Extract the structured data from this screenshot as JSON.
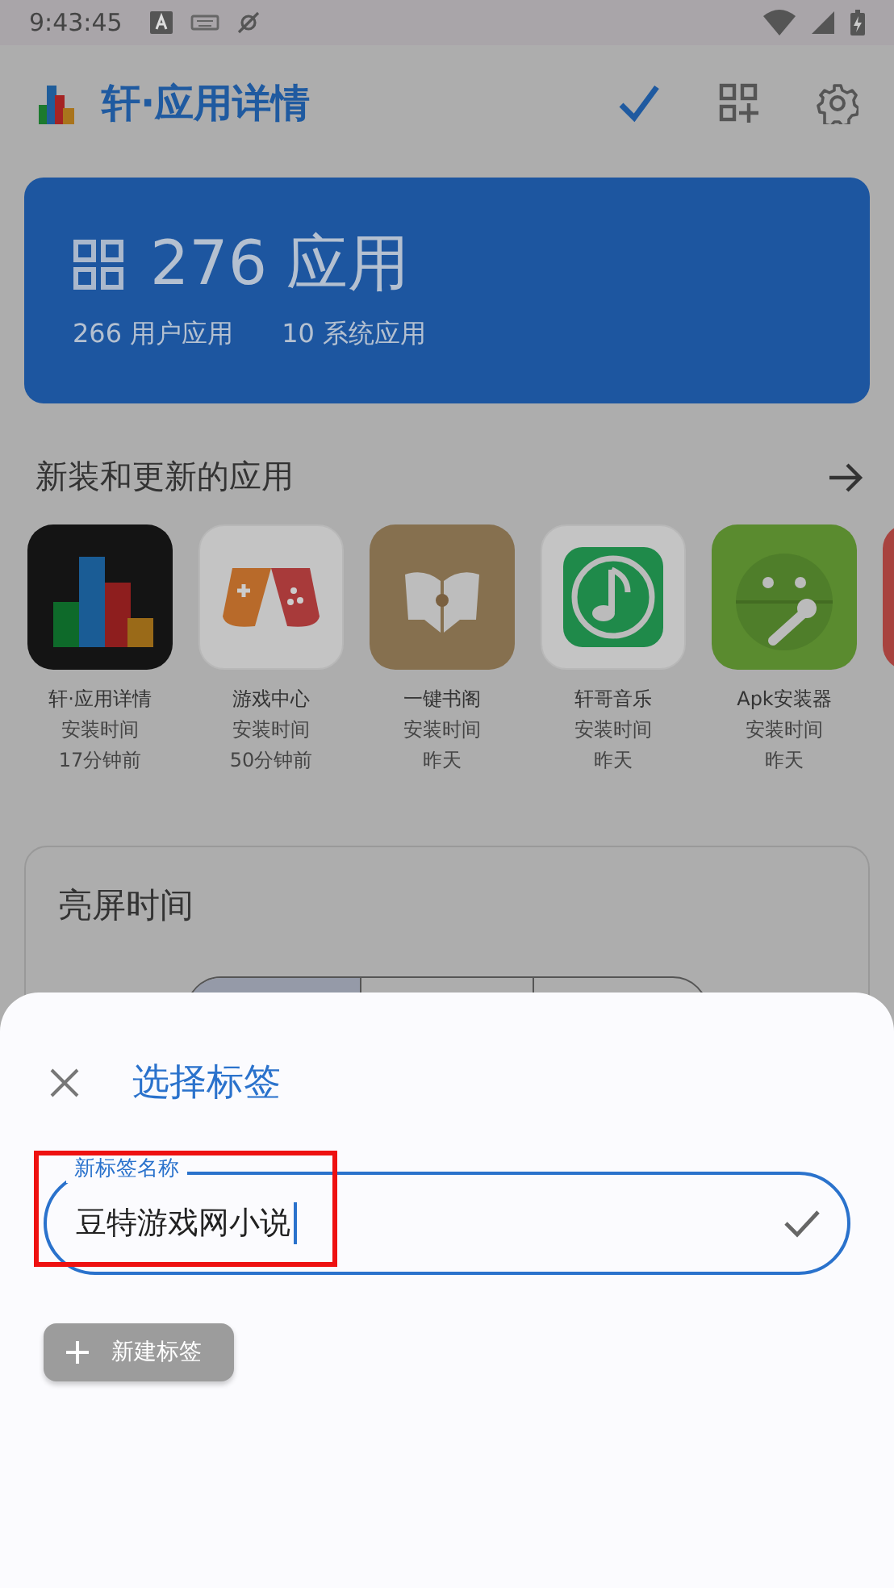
{
  "status_bar": {
    "time": "9:43:45"
  },
  "app_bar": {
    "title": "轩·应用详情"
  },
  "summary": {
    "count": "276 应用",
    "user_apps": "266 用户应用",
    "system_apps": "10 系统应用"
  },
  "recent": {
    "title": "新装和更新的应用",
    "apps": [
      {
        "kind": "bars",
        "name": "轩·应用详情",
        "label": "安装时间",
        "time": "17分钟前"
      },
      {
        "kind": "gamepad",
        "name": "游戏中心",
        "label": "安装时间",
        "time": "50分钟前"
      },
      {
        "kind": "book",
        "name": "一键书阁",
        "label": "安装时间",
        "time": "昨天"
      },
      {
        "kind": "music",
        "name": "轩哥音乐",
        "label": "安装时间",
        "time": "昨天"
      },
      {
        "kind": "android",
        "name": "Apk安装器",
        "label": "安装时间",
        "time": "昨天"
      },
      {
        "kind": "partial"
      }
    ]
  },
  "screen_time": {
    "title": "亮屏时间",
    "segments": [
      {
        "selected": true
      },
      {
        "selected": false
      },
      {
        "selected": false
      }
    ]
  },
  "sheet": {
    "title": "选择标签",
    "field": {
      "label": "新标签名称",
      "value": "豆特游戏网小说"
    },
    "new_button": {
      "label": "新建标签",
      "disabled": true
    }
  }
}
